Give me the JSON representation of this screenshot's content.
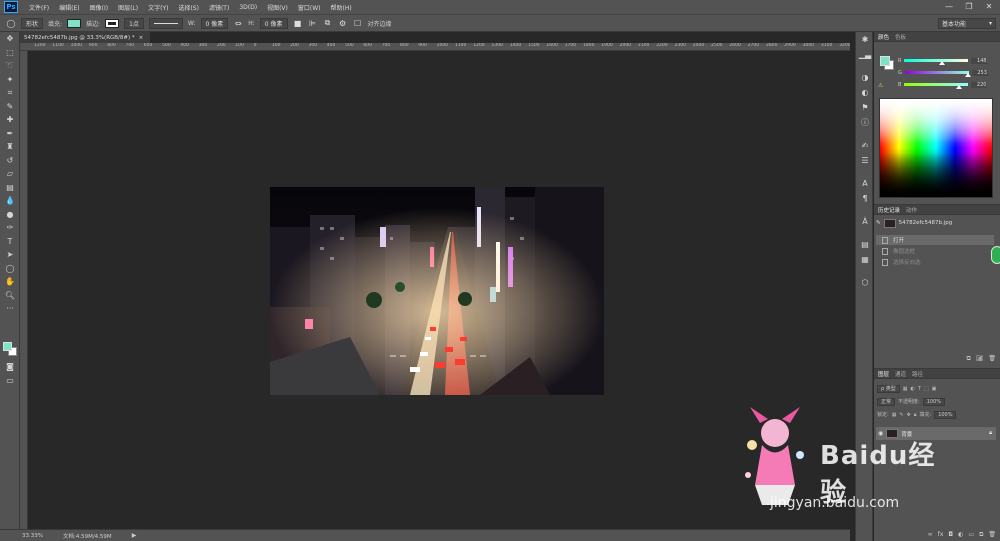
{
  "menubar": {
    "logo": "Ps",
    "items": [
      "文件(F)",
      "编辑(E)",
      "图像(I)",
      "图层(L)",
      "文字(Y)",
      "选择(S)",
      "滤镜(T)",
      "3D(D)",
      "视图(V)",
      "窗口(W)",
      "帮助(H)"
    ]
  },
  "window_controls": [
    "—",
    "❐",
    "✕"
  ],
  "options": {
    "mode": "形状",
    "fill_label": "填充:",
    "stroke_label": "描边:",
    "stroke_width": "1点",
    "w_label": "W:",
    "w_value": "0 像素",
    "link": "⇔",
    "h_label": "H:",
    "h_value": "0 像素",
    "align_edges": "对齐边缘",
    "workspace": "基本功能"
  },
  "document": {
    "tab_title": "54782efc5487b.jpg @ 33.3%(RGB/8#) *",
    "tab_close": "×"
  },
  "ruler_ticks": [
    "1200",
    "1100",
    "1000",
    "900",
    "800",
    "700",
    "600",
    "500",
    "400",
    "300",
    "200",
    "100",
    "0",
    "100",
    "200",
    "300",
    "400",
    "500",
    "600",
    "700",
    "800",
    "900",
    "1000",
    "1100",
    "1200",
    "1300",
    "1400",
    "1500",
    "1600",
    "1700",
    "1800",
    "1900",
    "2000",
    "2100",
    "2200",
    "2300",
    "2400",
    "2500",
    "2600",
    "2700",
    "2800",
    "2900",
    "3000",
    "3100",
    "3200"
  ],
  "status": {
    "zoom": "33.33%",
    "doc": "文档:4.59M/4.59M",
    "arrow": "▶"
  },
  "color_panel": {
    "tabs": [
      "颜色",
      "色板"
    ],
    "fg_color": "#7ce3c7",
    "rows": [
      {
        "label": "R",
        "value": "148",
        "pos": 0.58
      },
      {
        "label": "G",
        "value": "253",
        "pos": 0.99
      },
      {
        "label": "B",
        "value": "220",
        "pos": 0.86
      }
    ]
  },
  "history_panel": {
    "tabs": [
      "历史记录",
      "动作"
    ],
    "snapshot": "54782efc5487b.jpg",
    "items": [
      {
        "label": "打开",
        "state": "active"
      },
      {
        "label": "椭圆选框",
        "state": "faded"
      },
      {
        "label": "选择反向选",
        "state": "faded"
      }
    ]
  },
  "layers_panel": {
    "tabs": [
      "图层",
      "通道",
      "路径"
    ],
    "kind": "ρ 类型",
    "blend": "正常",
    "opacity_label": "不透明度:",
    "opacity": "100%",
    "lock_label": "锁定:",
    "fill_label": "填充:",
    "fill": "100%",
    "layer_name": "背景"
  },
  "watermark": {
    "brand": "Baidu经验",
    "url": "jingyan.baidu.com"
  }
}
